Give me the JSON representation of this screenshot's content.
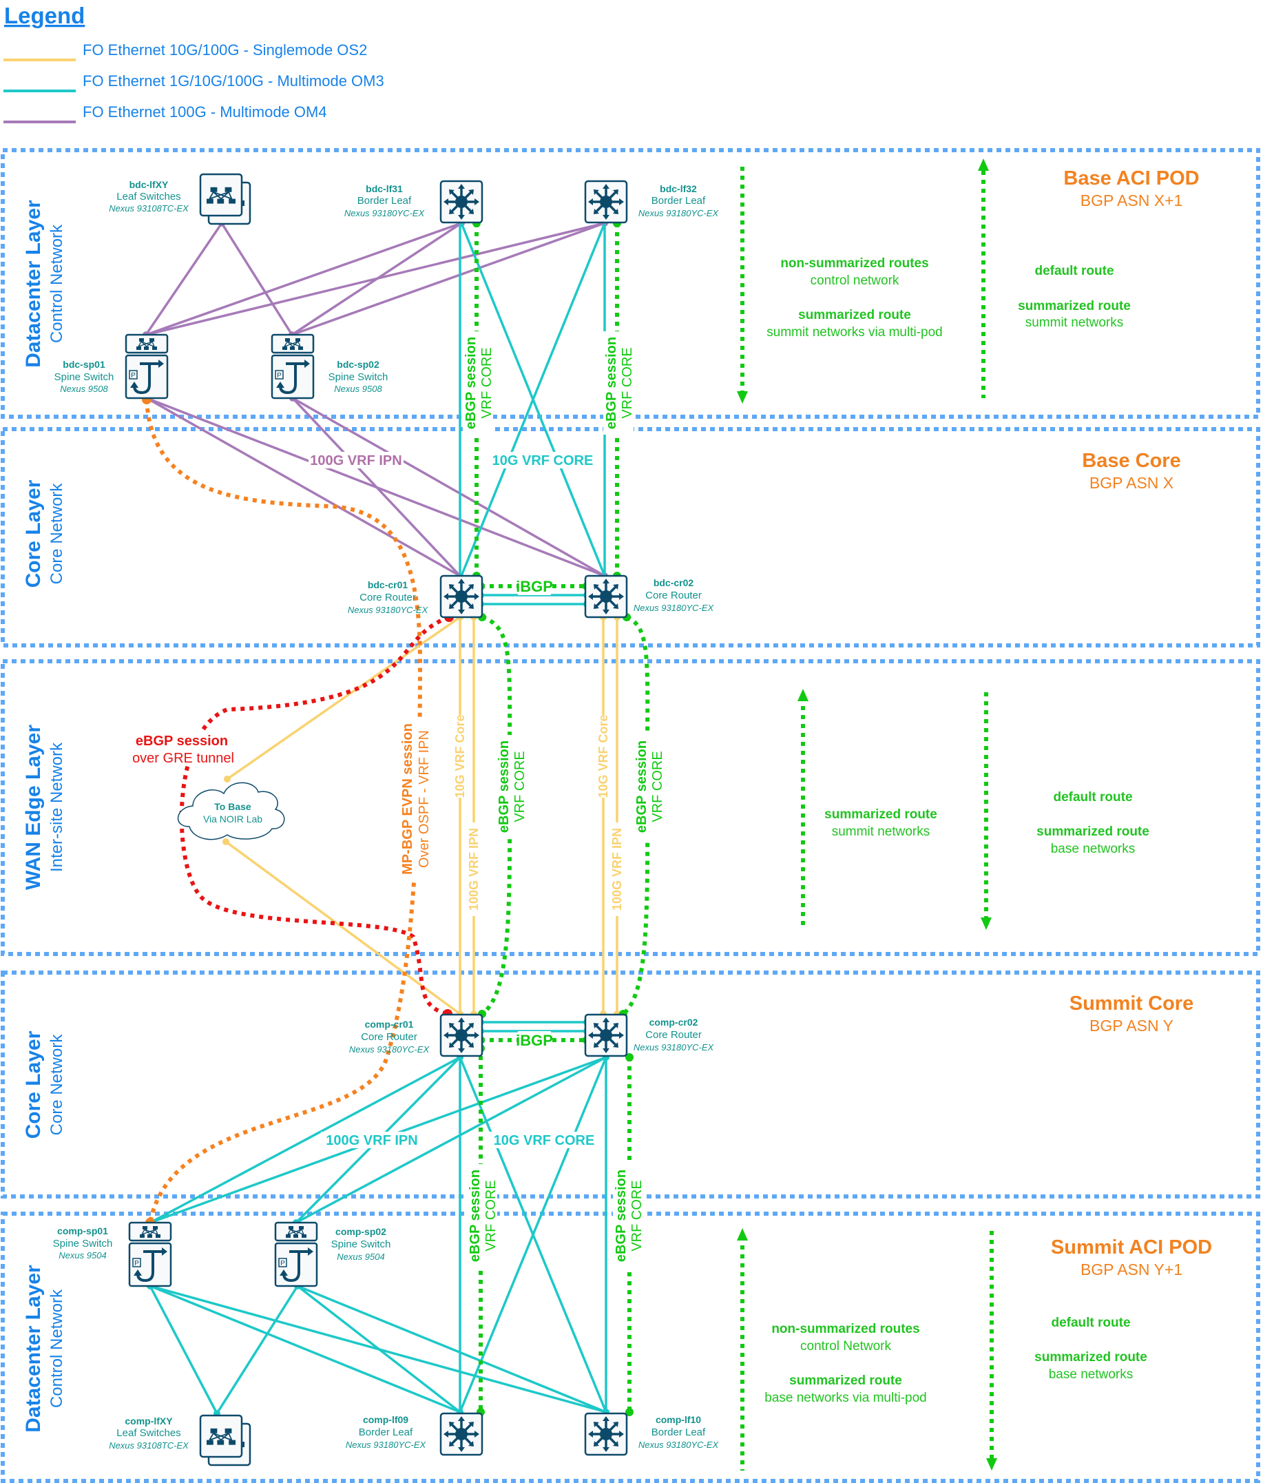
{
  "legend": {
    "title": "Legend",
    "items": [
      {
        "label": "FO Ethernet 10G/100G - Singlemode OS2",
        "color": "#f9d270"
      },
      {
        "label": "FO Ethernet 1G/10G/100G - Multimode OM3",
        "color": "#1ec8c8"
      },
      {
        "label": "FO Ethernet 100G - Multimode OM4",
        "color": "#a67ab8"
      }
    ]
  },
  "colors": {
    "layer_border": "#5ea8f5",
    "layer_title": "#1782e8",
    "node_text": "#12928e",
    "domain_title": "#f28220",
    "route_text": "#22c322",
    "ebgp_green": "#12c912",
    "gre_red": "#e81414",
    "evpn_orange": "#f58220",
    "icon_dark": "#0d4a6a"
  },
  "layers": [
    {
      "title": "Datacenter Layer",
      "subtitle": "Control Network"
    },
    {
      "title": "Core Layer",
      "subtitle": "Core Network"
    },
    {
      "title": "WAN Edge Layer",
      "subtitle": "Inter-site Network"
    },
    {
      "title": "Core Layer",
      "subtitle": "Core Network"
    },
    {
      "title": "Datacenter Layer",
      "subtitle": "Control Network"
    }
  ],
  "domains": [
    {
      "title": "Base ACI POD",
      "asn": "BGP ASN X+1"
    },
    {
      "title": "Base Core",
      "asn": "BGP ASN X"
    },
    {
      "title": "Summit Core",
      "asn": "BGP ASN Y"
    },
    {
      "title": "Summit ACI POD",
      "asn": "BGP ASN Y+1"
    }
  ],
  "nodes": {
    "bdc_lfxy": {
      "name": "bdc-lfXY",
      "role": "Leaf Switches",
      "model": "Nexus 93108TC-EX"
    },
    "bdc_lf31": {
      "name": "bdc-lf31",
      "role": "Border Leaf",
      "model": "Nexus 93180YC-EX"
    },
    "bdc_lf32": {
      "name": "bdc-lf32",
      "role": "Border Leaf",
      "model": "Nexus 93180YC-EX"
    },
    "bdc_sp01": {
      "name": "bdc-sp01",
      "role": "Spine Switch",
      "model": "Nexus 9508"
    },
    "bdc_sp02": {
      "name": "bdc-sp02",
      "role": "Spine Switch",
      "model": "Nexus 9508"
    },
    "bdc_cr01": {
      "name": "bdc-cr01",
      "role": "Core Router",
      "model": "Nexus 93180YC-EX"
    },
    "bdc_cr02": {
      "name": "bdc-cr02",
      "role": "Core Router",
      "model": "Nexus 93180YC-EX"
    },
    "comp_cr01": {
      "name": "comp-cr01",
      "role": "Core Router",
      "model": "Nexus 93180YC-EX"
    },
    "comp_cr02": {
      "name": "comp-cr02",
      "role": "Core Router",
      "model": "Nexus 93180YC-EX"
    },
    "comp_sp01": {
      "name": "comp-sp01",
      "role": "Spine Switch",
      "model": "Nexus 9504"
    },
    "comp_sp02": {
      "name": "comp-sp02",
      "role": "Spine Switch",
      "model": "Nexus 9504"
    },
    "comp_lfxy": {
      "name": "comp-lfXY",
      "role": "Leaf Switches",
      "model": "Nexus 93108TC-EX"
    },
    "comp_lf09": {
      "name": "comp-lf09",
      "role": "Border Leaf",
      "model": "Nexus 93180YC-EX"
    },
    "comp_lf10": {
      "name": "comp-lf10",
      "role": "Border Leaf",
      "model": "Nexus 93180YC-EX"
    }
  },
  "cloud": {
    "title": "To Base",
    "subtitle": "Via NOIR Lab"
  },
  "link_labels": {
    "base_ipn": "100G VRF IPN",
    "base_core": "10G VRF CORE",
    "summit_ipn": "100G VRF IPN",
    "summit_core": "10G VRF CORE",
    "ibgp": "iBGP",
    "wan_10g": "10G VRF Core",
    "wan_100g": "100G VRF IPN",
    "ebgp_bold": "eBGP session",
    "ebgp_vrf": "VRF CORE",
    "gre_bold": "eBGP session",
    "gre_sub": "over GRE tunnel",
    "evpn_bold": "MP-BGP EVPN session",
    "evpn_sub": "Over OSPF - VRF IPN"
  },
  "routes": {
    "base_pod_down": [
      {
        "bold": "non-summarized routes",
        "sub": "control network"
      },
      {
        "bold": "summarized route",
        "sub": "summit networks via multi-pod"
      }
    ],
    "base_pod_up": [
      {
        "bold": "default route",
        "sub": ""
      },
      {
        "bold": "summarized route",
        "sub": "summit networks"
      }
    ],
    "wan_up": [
      {
        "bold": "summarized route",
        "sub": "summit networks"
      }
    ],
    "wan_down": [
      {
        "bold": "default route",
        "sub": ""
      },
      {
        "bold": "summarized route",
        "sub": "base networks"
      }
    ],
    "summit_pod_up": [
      {
        "bold": "non-summarized routes",
        "sub": "control Network"
      },
      {
        "bold": "summarized route",
        "sub": "base networks via multi-pod"
      }
    ],
    "summit_pod_down": [
      {
        "bold": "default route",
        "sub": ""
      },
      {
        "bold": "summarized route",
        "sub": "base networks"
      }
    ]
  }
}
